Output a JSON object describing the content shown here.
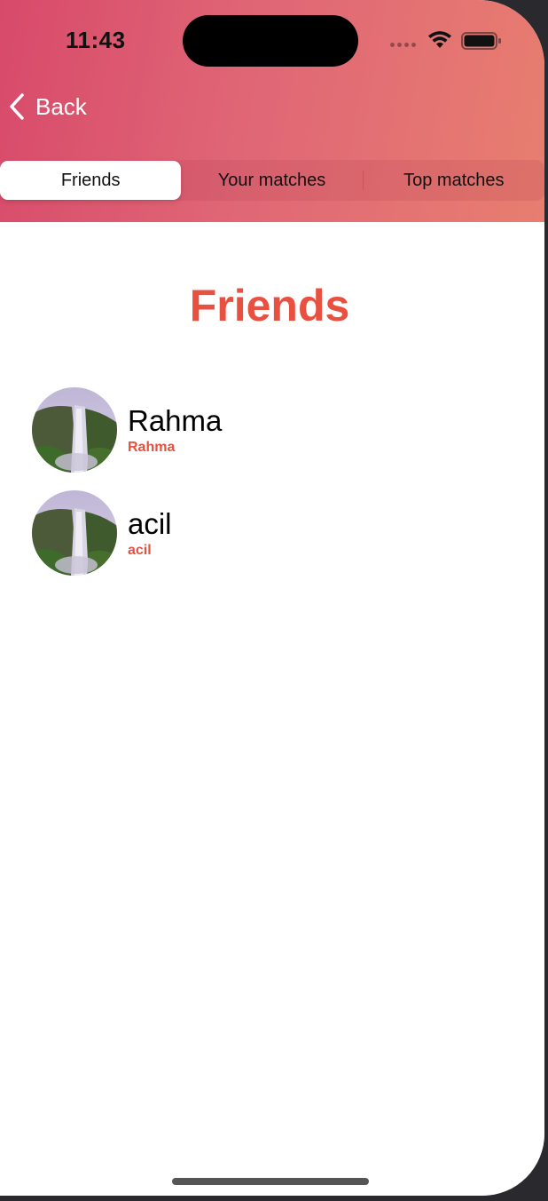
{
  "status_bar": {
    "time": "11:43"
  },
  "nav": {
    "back_label": "Back"
  },
  "tabs": [
    {
      "label": "Friends",
      "active": true
    },
    {
      "label": "Your matches",
      "active": false
    },
    {
      "label": "Top matches",
      "active": false
    }
  ],
  "page": {
    "title": "Friends"
  },
  "friends": [
    {
      "name": "Rahma",
      "username": "Rahma"
    },
    {
      "name": "acil",
      "username": "acil"
    }
  ],
  "colors": {
    "accent": "#e8503f",
    "gradient_start": "#d84a6a",
    "gradient_end": "#e8806f"
  },
  "icons": {
    "back": "chevron-left-icon",
    "wifi": "wifi-icon",
    "battery": "battery-icon",
    "signal": "signal-dots-icon"
  }
}
